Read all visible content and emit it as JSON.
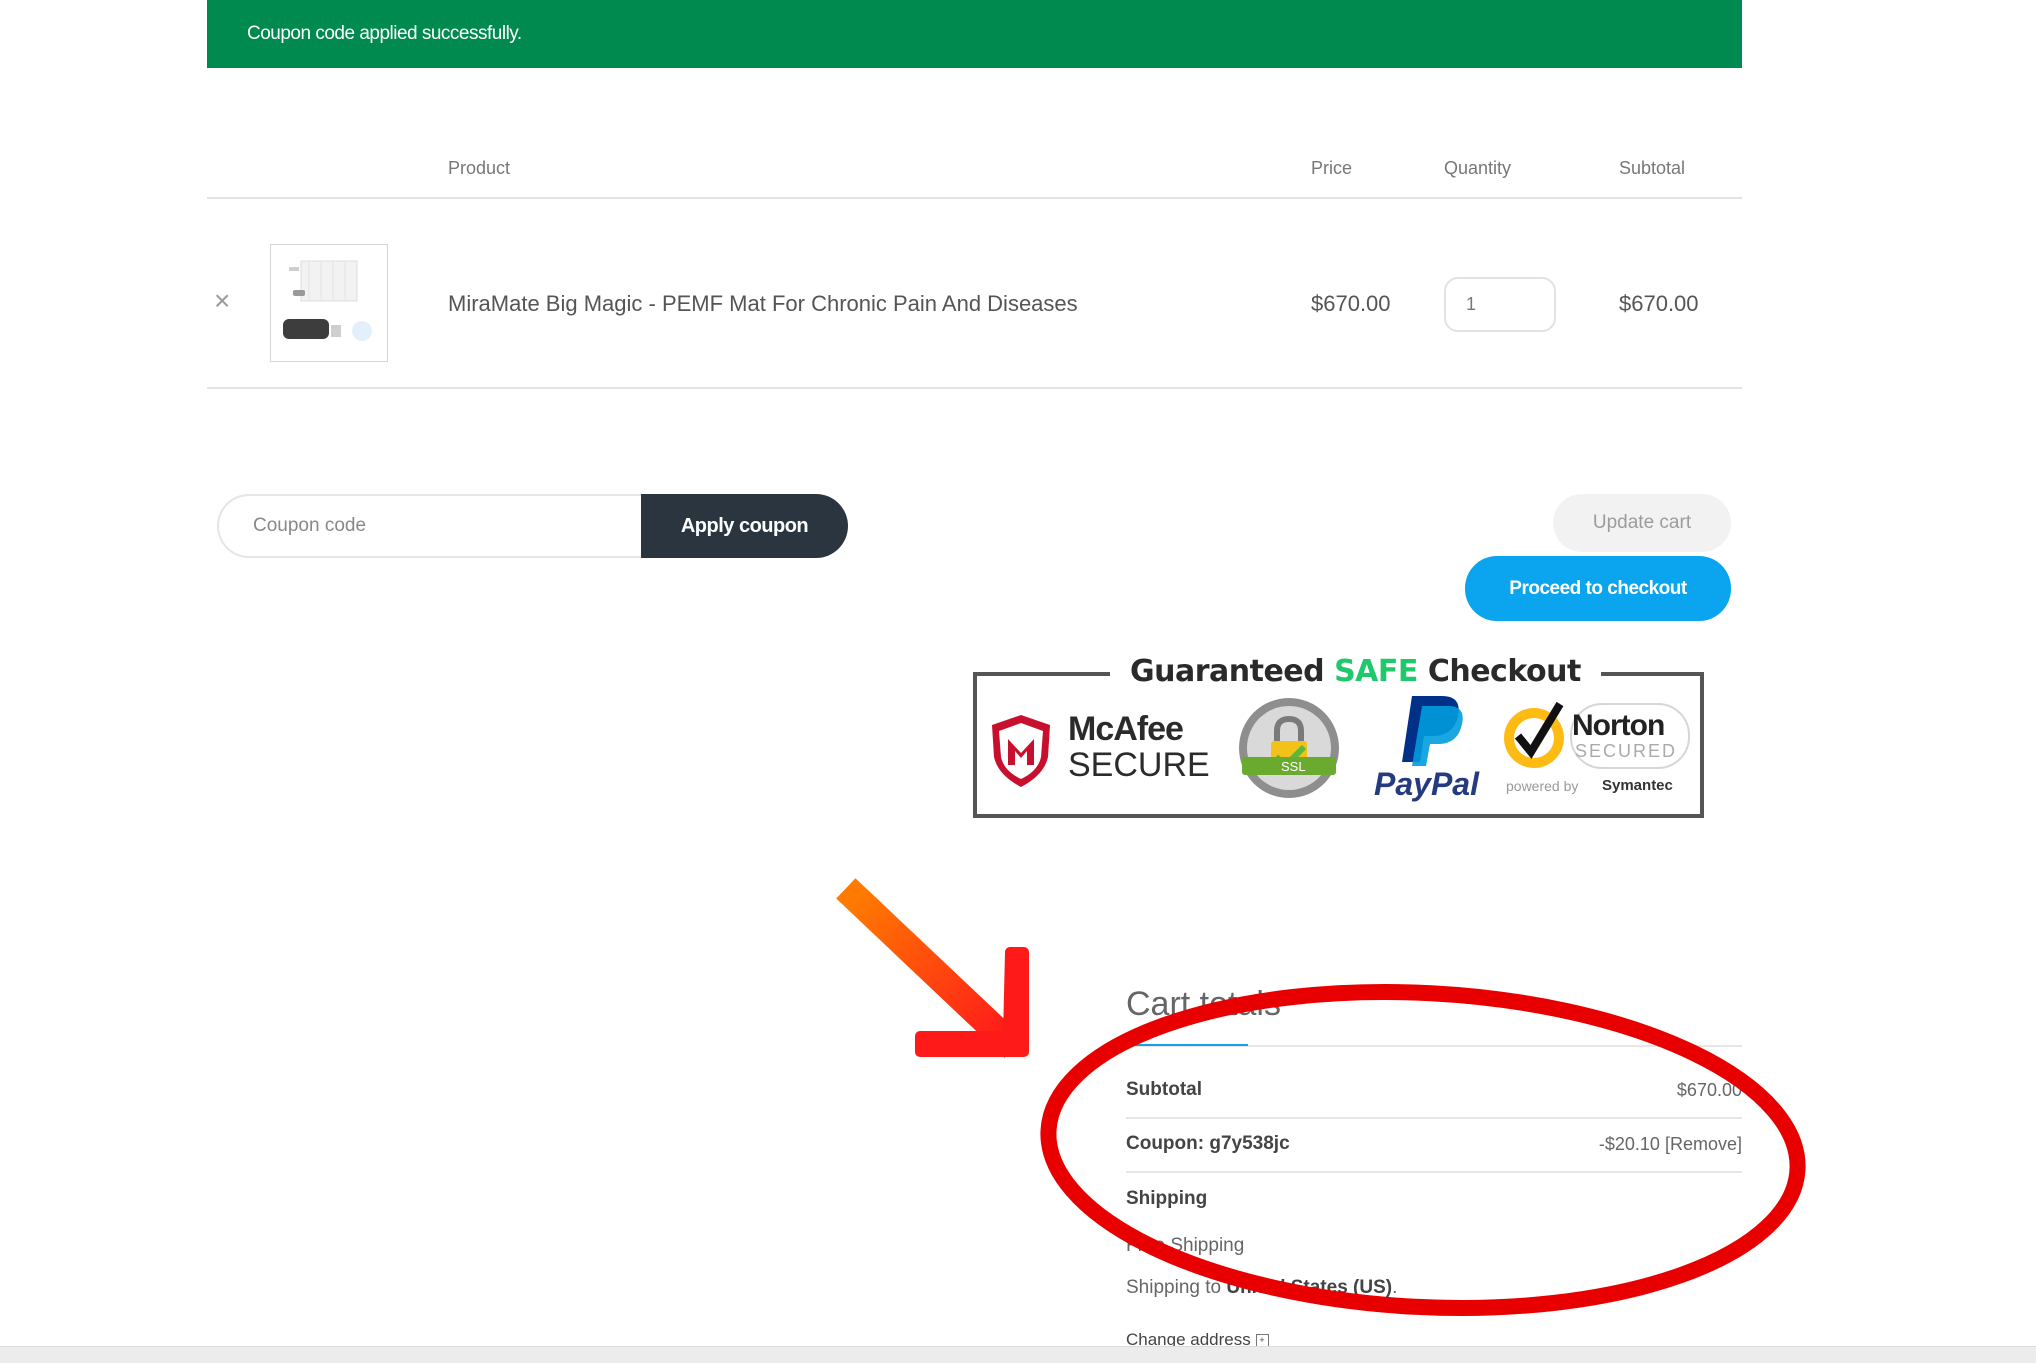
{
  "notice": {
    "message": "Coupon code applied successfully."
  },
  "cart_table": {
    "headers": {
      "product": "Product",
      "price": "Price",
      "quantity": "Quantity",
      "subtotal": "Subtotal"
    },
    "rows": [
      {
        "remove_glyph": "×",
        "name": "MiraMate Big Magic - PEMF Mat For Chronic Pain And Diseases",
        "price": "$670.00",
        "quantity": "1",
        "subtotal": "$670.00"
      }
    ]
  },
  "coupon": {
    "placeholder": "Coupon code",
    "apply_label": "Apply coupon"
  },
  "actions": {
    "update_label": "Update cart",
    "checkout_label": "Proceed to checkout"
  },
  "trust_badge": {
    "title_pre": "Guaranteed ",
    "title_safe": "SAFE",
    "title_post": " Checkout",
    "mcafee_1": "McAfee",
    "mcafee_2": "SECURE",
    "ssl": "SSL",
    "paypal": "PayPal",
    "norton_1": "Norton",
    "norton_2": "SECURED",
    "norton_3": "powered by",
    "norton_4": "Symantec"
  },
  "totals": {
    "title": "Cart totals",
    "subtotal_label": "Subtotal",
    "subtotal_value": "$670.00",
    "coupon_label": "Coupon: g7y538jc",
    "coupon_value": "-$20.10",
    "coupon_remove": "[Remove]",
    "shipping_label": "Shipping",
    "shipping_method": "Free Shipping",
    "shipping_to_pre": "Shipping to ",
    "shipping_to_country": "United States (US)",
    "shipping_to_post": ".",
    "change_address": "Change address"
  },
  "colors": {
    "notice_bg": "#008a4f",
    "checkout_blue": "#0ba4ef",
    "apply_dark": "#2b3540",
    "annotation_red": "#e80000"
  }
}
